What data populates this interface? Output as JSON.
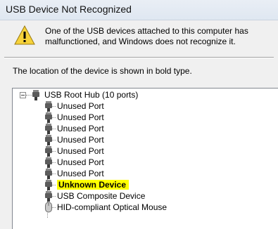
{
  "window": {
    "title": "USB Device Not Recognized"
  },
  "message": {
    "text": "One of the USB devices attached to this computer has malfunctioned, and Windows does not recognize it.",
    "icon": "warning-icon"
  },
  "location_text": "The location of the device is shown in bold type.",
  "tree": {
    "root": {
      "label": "USB Root Hub (10 ports)",
      "icon": "usb-plug-icon",
      "expanded": true
    },
    "children": [
      {
        "label": "Unused Port",
        "icon": "usb-plug-icon"
      },
      {
        "label": "Unused Port",
        "icon": "usb-plug-icon"
      },
      {
        "label": "Unused Port",
        "icon": "usb-plug-icon"
      },
      {
        "label": "Unused Port",
        "icon": "usb-plug-icon"
      },
      {
        "label": "Unused Port",
        "icon": "usb-plug-icon"
      },
      {
        "label": "Unused Port",
        "icon": "usb-plug-icon"
      },
      {
        "label": "Unused Port",
        "icon": "usb-plug-icon"
      },
      {
        "label": "Unknown Device",
        "icon": "usb-plug-icon",
        "bold": true,
        "highlight_color": "#ffff00"
      },
      {
        "label": "USB Composite Device",
        "icon": "usb-plug-icon"
      },
      {
        "label": "HID-compliant Optical Mouse",
        "icon": "mouse-icon"
      }
    ]
  },
  "colors": {
    "highlight": "#ffff00",
    "titlebar": "#e3eaf3"
  }
}
